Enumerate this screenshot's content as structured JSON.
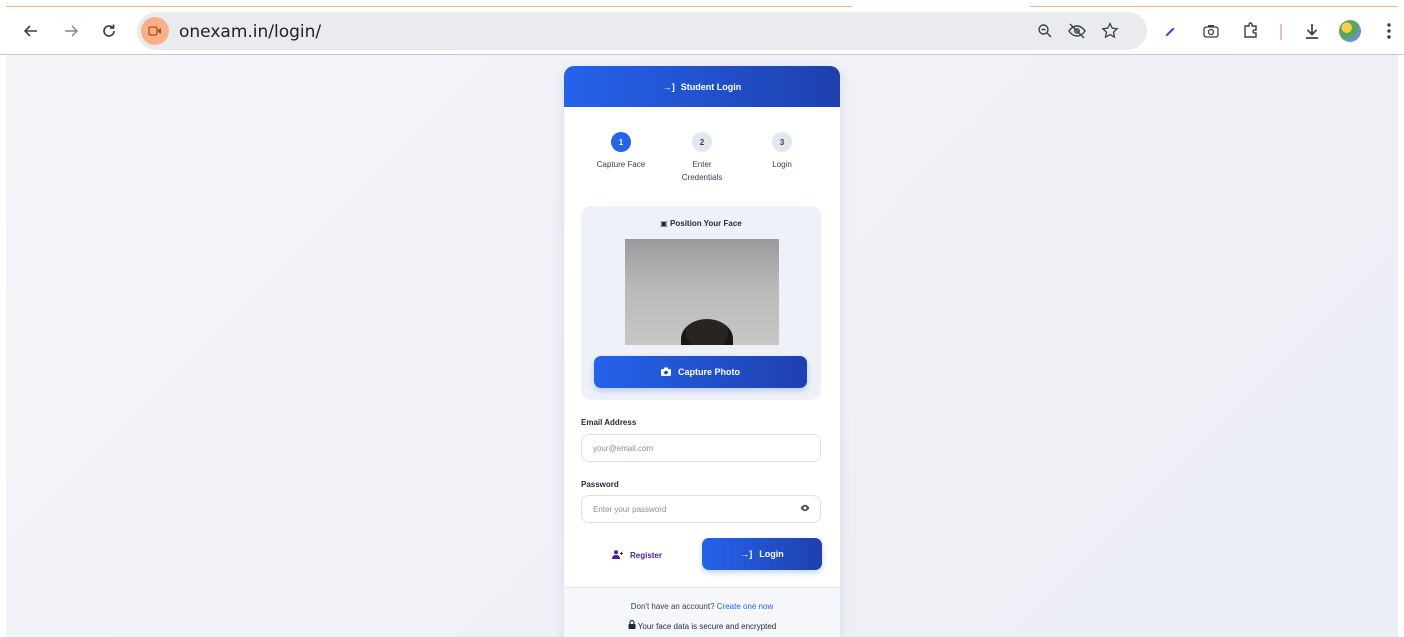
{
  "browser": {
    "url": "onexam.in/login/",
    "icons": [
      "back-arrow-icon",
      "forward-arrow-icon",
      "reload-icon",
      "camera-in-use-icon",
      "zoom-icon",
      "tracking-protection-icon",
      "bookmark-star-icon",
      "pen-icon",
      "screenshot-icon",
      "extensions-icon",
      "download-icon",
      "profile-avatar",
      "menu-dots-icon"
    ],
    "accent": "#f7b089"
  },
  "card": {
    "header_title": "Student Login",
    "accent_color": "#2563eb",
    "steps": [
      {
        "number": "1",
        "label": "Capture Face",
        "active": true
      },
      {
        "number": "2",
        "label": "Enter Credentials",
        "active": false
      },
      {
        "number": "3",
        "label": "Login",
        "active": false
      }
    ],
    "face": {
      "title": "Position Your Face",
      "capture_label": "Capture Photo"
    },
    "email": {
      "label": "Email Address",
      "placeholder": "your@email.com",
      "value": ""
    },
    "password": {
      "label": "Password",
      "placeholder": "Enter your password",
      "value": ""
    },
    "register_label": "Register",
    "login_label": "Login",
    "footer": {
      "prompt": "Don't have an account?",
      "link": "Create one now",
      "security_note": "Your face data is secure and encrypted"
    }
  }
}
